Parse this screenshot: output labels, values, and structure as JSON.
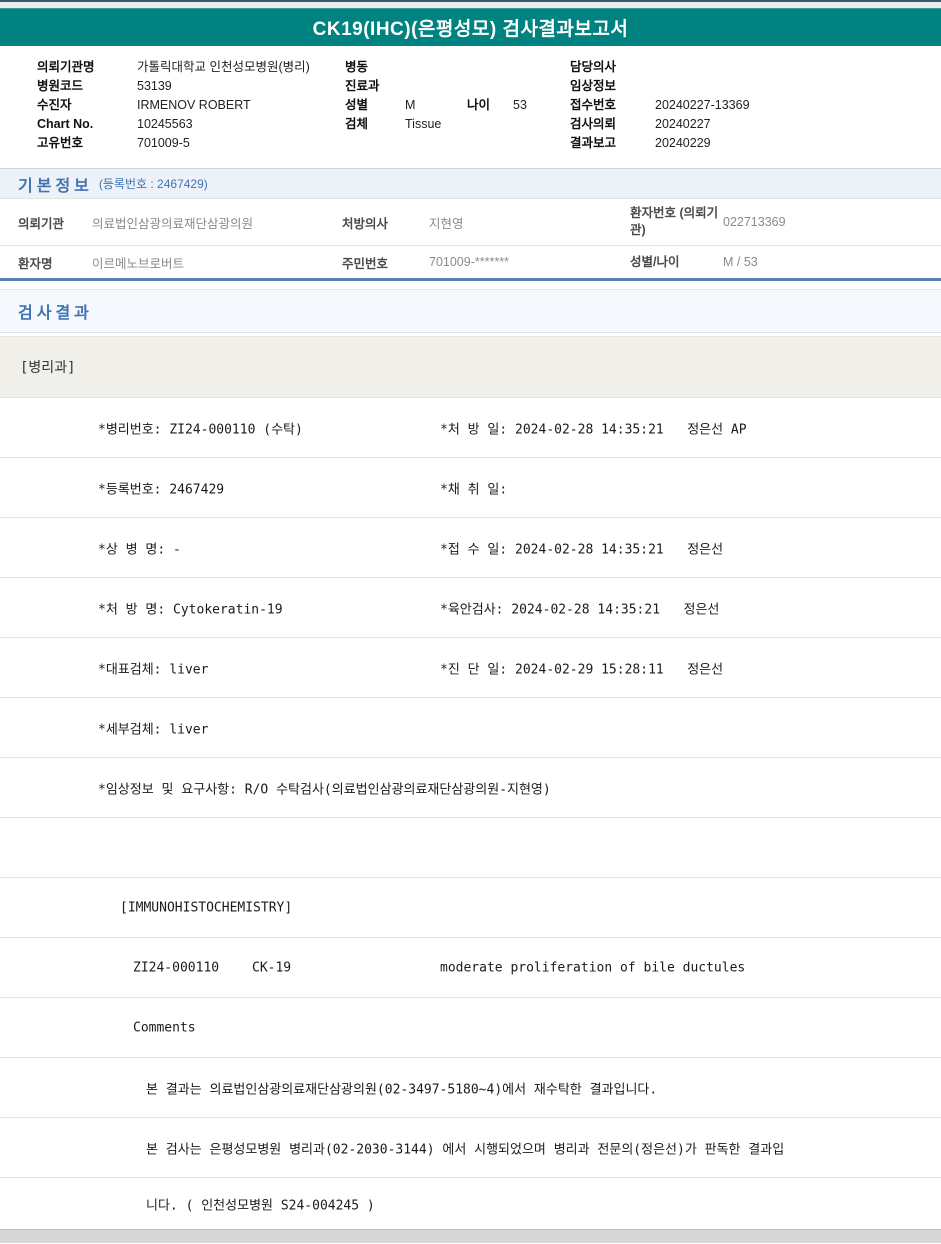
{
  "banner": {
    "title": "CK19(IHC)(은평성모) 검사결과보고서"
  },
  "colors": {
    "banner_teal": "#008280",
    "section_blue": "#4173b4",
    "table_bottom_border": "#5b82ad"
  },
  "patient_header": {
    "left": [
      {
        "label": "의뢰기관명",
        "value": "가톨릭대학교 인천성모병원(병리)"
      },
      {
        "label": "병원코드",
        "value": "53139"
      },
      {
        "label": "수진자",
        "value": "IRMENOV ROBERT"
      },
      {
        "label": "Chart No.",
        "value": "10245563"
      },
      {
        "label": "고유번호",
        "value": "701009-5"
      }
    ],
    "middle": [
      {
        "label": "병동",
        "value": ""
      },
      {
        "label": "진료과",
        "value": ""
      },
      {
        "label": "성별",
        "value": "M",
        "label2": "나이",
        "value2": "53"
      },
      {
        "label": "검체",
        "value": "Tissue"
      }
    ],
    "right": [
      {
        "label": "담당의사",
        "value": ""
      },
      {
        "label": "임상정보",
        "value": ""
      },
      {
        "label": "접수번호",
        "value": "20240227-13369"
      },
      {
        "label": "검사의뢰",
        "value": "20240227"
      },
      {
        "label": "결과보고",
        "value": "20240229"
      }
    ]
  },
  "basic_info": {
    "title": "기본정보",
    "subtitle": "(등록번호 : 2467429)",
    "rows": [
      {
        "c1_label": "의뢰기관",
        "c1_value": "의료법인삼광의료재단삼광의원",
        "c2_label": "처방의사",
        "c2_value": "지현영",
        "c3_label": "환자번호 (의뢰기관)",
        "c3_value": "022713369"
      },
      {
        "c1_label": "환자명",
        "c1_value": "이르메노브로버트",
        "c2_label": "주민번호",
        "c2_value": "701009-*******",
        "c3_label": "성별/나이",
        "c3_value": "M / 53"
      }
    ]
  },
  "results": {
    "title": "검사결과",
    "department": "[병리과]",
    "detail_rows": [
      {
        "left": "*병리번호: ZI24-000110 (수탁)",
        "right": "*처 방 일: 2024-02-28 14:35:21   정은선 AP"
      },
      {
        "left": "*등록번호: 2467429",
        "right": "*채 취 일:"
      },
      {
        "left": "*상 병 명: -",
        "right": "*접 수 일: 2024-02-28 14:35:21   정은선"
      },
      {
        "left": "*처 방 명: Cytokeratin-19",
        "right": "*육안검사: 2024-02-28 14:35:21   정은선"
      },
      {
        "left": "*대표검체: liver",
        "right": "*진 단 일: 2024-02-29 15:28:11   정은선"
      },
      {
        "left": "*세부검체: liver",
        "right": ""
      }
    ],
    "clinical_info": "*임상정보 및 요구사항: R/O 수탁검사(의료법인삼광의료재단삼광의원-지현영)",
    "ihc_header": "[IMMUNOHISTOCHEMISTRY]",
    "ihc_result": {
      "specimen_no": "ZI24-000110",
      "test_name": "CK-19",
      "finding": "moderate proliferation of bile ductules"
    },
    "comments_label": "Comments",
    "comment_lines": [
      "본 결과는 의료법인삼광의료재단삼광의원(02-3497-5180~4)에서 재수탁한 결과입니다.",
      "본 검사는 은평성모병원 병리과(02-2030-3144) 에서 시행되었으며 병리과 전문의(정은선)가 판독한 결과입",
      "니다. ( 인천성모병원 S24-004245 )"
    ]
  }
}
